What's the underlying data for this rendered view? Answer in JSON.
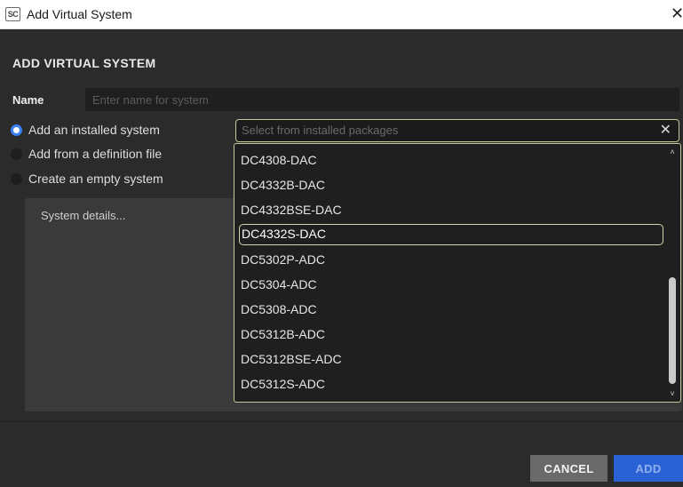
{
  "window": {
    "icon_text": "SC",
    "title": "Add Virtual System",
    "close_glyph": "✕"
  },
  "dialog": {
    "heading": "ADD VIRTUAL SYSTEM",
    "name_label": "Name",
    "name_value": "",
    "name_placeholder": "Enter name for system",
    "options": [
      {
        "label": "Add an installed system",
        "checked": true
      },
      {
        "label": "Add from a definition file",
        "checked": false
      },
      {
        "label": "Create an empty system",
        "checked": false
      }
    ],
    "details_text": "System details...",
    "combo": {
      "placeholder": "Select from installed packages",
      "clear_glyph": "✕"
    },
    "packages": [
      "DC4308-DAC",
      "DC4332B-DAC",
      "DC4332BSE-DAC",
      "DC4332S-DAC",
      "DC5302P-ADC",
      "DC5304-ADC",
      "DC5308-ADC",
      "DC5312B-ADC",
      "DC5312BSE-ADC",
      "DC5312S-ADC"
    ],
    "highlighted_package": "DC4332S-DAC",
    "buttons": {
      "cancel": "CANCEL",
      "add": "ADD"
    }
  },
  "colors": {
    "accent_blue": "#3b82f6",
    "add_button": "#2a62d6",
    "dropdown_border": "#c8c59a",
    "background": "#2b2b2b"
  }
}
